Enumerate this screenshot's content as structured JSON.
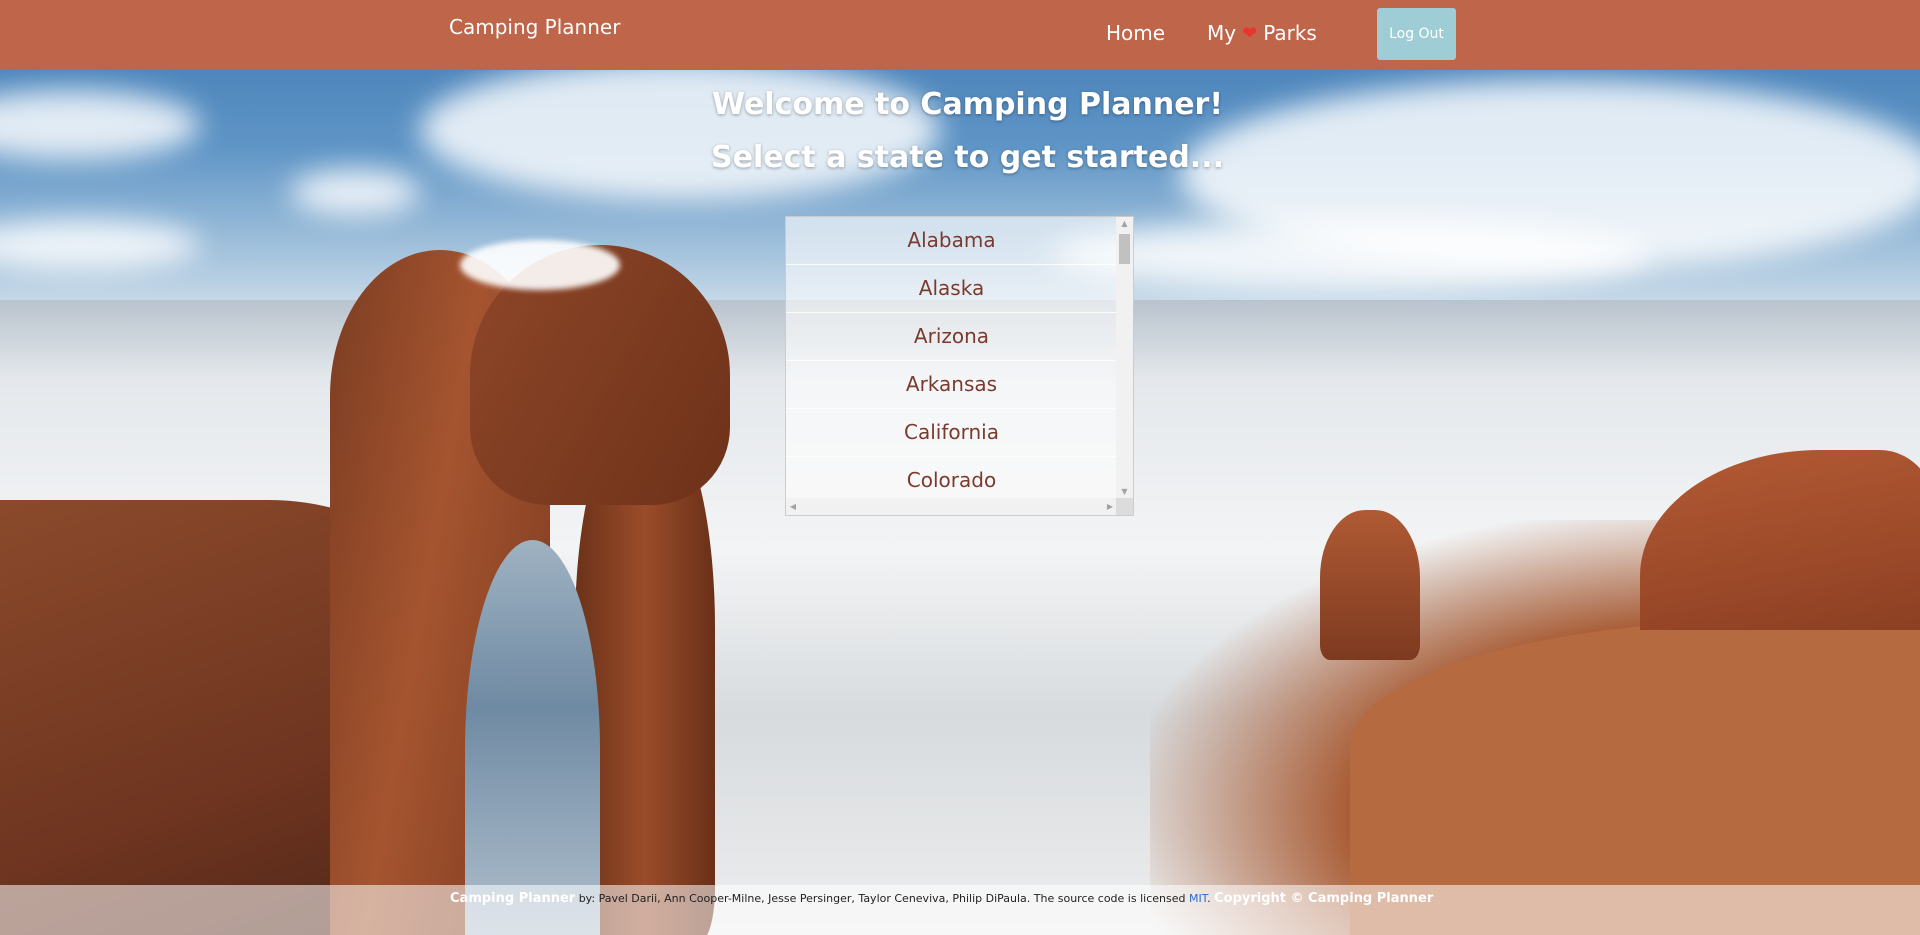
{
  "header": {
    "brand": "Camping Planner",
    "nav": {
      "home": "Home",
      "parks_prefix": "My",
      "parks_suffix": "Parks",
      "heart_icon": "heart-icon"
    },
    "logout_label": "Log Out"
  },
  "welcome": {
    "title": "Welcome to Camping Planner!",
    "subtitle": "Select a state to get started..."
  },
  "states": [
    "Alabama",
    "Alaska",
    "Arizona",
    "Arkansas",
    "California",
    "Colorado"
  ],
  "footer": {
    "brand": "Camping Planner",
    "by_text": " by: Pavel Darii, Ann Cooper-Milne, Jesse Persinger, Taylor Ceneviva, Philip DiPaula. The source code is licensed ",
    "license_link": "MIT",
    "after_link": ". ",
    "copyright": "Copyright © Camping Planner"
  },
  "colors": {
    "navbar": "#be654a",
    "logout_button": "#9fcdd6",
    "state_text": "#7a3b2e",
    "heart": "#e8362d"
  }
}
